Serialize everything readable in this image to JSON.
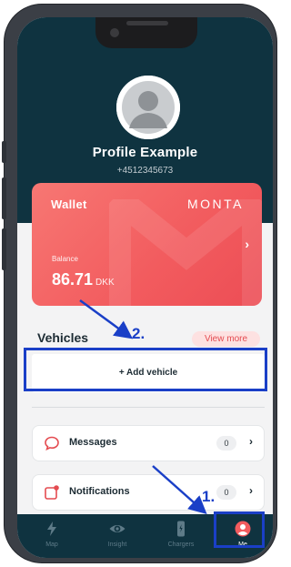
{
  "profile": {
    "name": "Profile Example",
    "phone": "+4512345673"
  },
  "wallet": {
    "title": "Wallet",
    "brand": "MONTA",
    "balance_label": "Balance",
    "balance_amount": "86.71",
    "currency": "DKK",
    "color": "#f25b5e"
  },
  "vehicles": {
    "title": "Vehicles",
    "view_more": "View more",
    "add_vehicle": "+ Add vehicle"
  },
  "menu": [
    {
      "label": "Messages",
      "count": "0",
      "icon": "chat-bubble-icon"
    },
    {
      "label": "Notifications",
      "count": "0",
      "icon": "notification-icon"
    }
  ],
  "tabs": [
    {
      "label": "Map",
      "icon": "lightning-icon"
    },
    {
      "label": "Insight",
      "icon": "eye-icon"
    },
    {
      "label": "Chargers",
      "icon": "charger-icon"
    },
    {
      "label": "Me",
      "icon": "user-icon",
      "active": true
    }
  ],
  "annotations": {
    "step1": "1.",
    "step2": "2.",
    "color": "#1a3fc7"
  },
  "colors": {
    "header": "#0f3340",
    "accent": "#e44b50"
  }
}
